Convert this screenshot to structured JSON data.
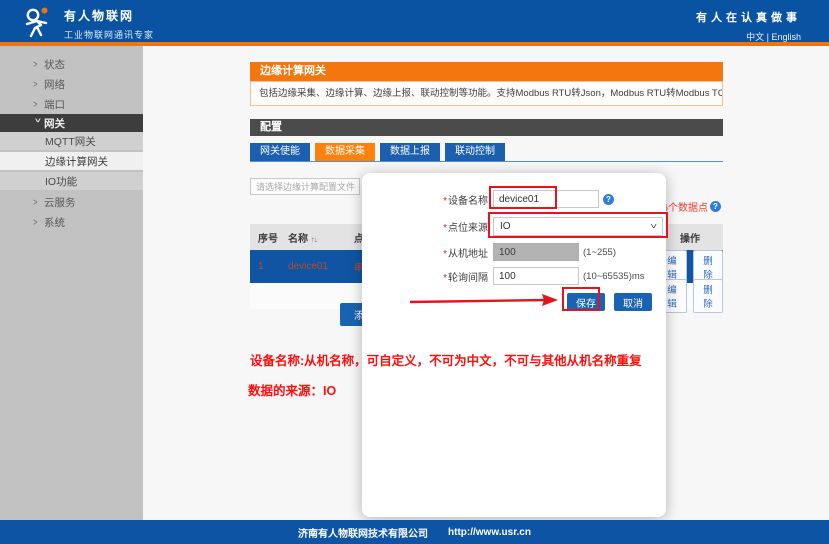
{
  "header": {
    "brand": "有人物联网",
    "slogan": "工业物联网通讯专家",
    "tagline": "有人在认真做事",
    "lang": "中文 | English"
  },
  "sidebar": {
    "items": [
      {
        "label": "状态"
      },
      {
        "label": "网络"
      },
      {
        "label": "端口"
      },
      {
        "label": "网关"
      },
      {
        "label": "MQTT网关"
      },
      {
        "label": "边缘计算网关"
      },
      {
        "label": "IO功能"
      },
      {
        "label": "云服务"
      },
      {
        "label": "系统"
      }
    ]
  },
  "page": {
    "title": "边缘计算网关",
    "description": "包括边缘采集、边缘计算、边缘上报、联动控制等功能。支持Modbus RTU转Json，Modbus RTU转Modbus TCP等通用工业协议转换。",
    "section_title": "配置"
  },
  "tabs": [
    {
      "label": "网关使能"
    },
    {
      "label": "数据采集"
    },
    {
      "label": "数据上报"
    },
    {
      "label": "联动控制"
    }
  ],
  "toolbar": {
    "file_placeholder": "请选择边缘计算配置文件",
    "points_badge": "126个数据点"
  },
  "table": {
    "headers": {
      "index": "序号",
      "name": "名称",
      "source": "点位来源",
      "action": "操作"
    },
    "rows": [
      {
        "index": "1",
        "name": "device01",
        "source": "串口1",
        "edit_label": "编辑",
        "delete_label": "删除"
      },
      {
        "index": "",
        "name": "",
        "source": "",
        "edit_label": "编辑",
        "delete_label": "删除"
      }
    ],
    "add_label": "添加"
  },
  "modal": {
    "required_mark": "*",
    "fields": [
      {
        "label": "设备名称",
        "value": "device01"
      },
      {
        "label": "点位来源",
        "value": "IO"
      },
      {
        "label": "从机地址",
        "value": "100",
        "hint": "(1~255)"
      },
      {
        "label": "轮询间隔",
        "value": "100",
        "hint": "(10~65535)ms"
      }
    ],
    "save_label": "保存",
    "cancel_label": "取消"
  },
  "annotations": {
    "line1": "设备名称:从机名称，可自定义，不可为中文，不可与其他从机名称重复",
    "line2": "数据的来源：IO"
  },
  "footer": {
    "company": "济南有人物联网技术有限公司",
    "url": "http://www.usr.cn"
  },
  "icons": {
    "chevron": ">",
    "sort": "↑↓",
    "info": "?",
    "caret": ">"
  },
  "colors": {
    "primary_blue": "#0a53a2",
    "accent_orange": "#f3770e",
    "selected_row_blue": "#0f55a3",
    "annotation_red": "#e5131d",
    "badge_red": "#e9402f"
  }
}
